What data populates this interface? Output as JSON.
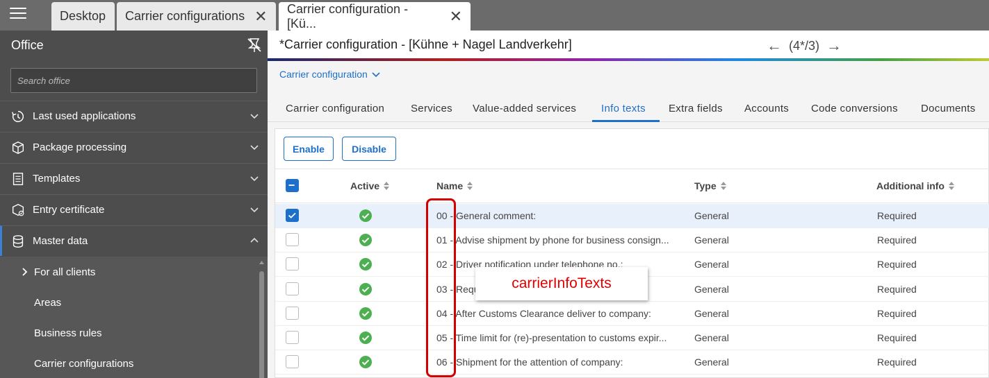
{
  "tabs": [
    {
      "label": "Desktop"
    },
    {
      "label": "Carrier configurations"
    },
    {
      "label": "Carrier configuration - [Kü..."
    }
  ],
  "sidebar": {
    "title": "Office",
    "search_placeholder": "Search office",
    "items": [
      {
        "label": "Last used applications",
        "icon": "history-icon"
      },
      {
        "label": "Package processing",
        "icon": "package-icon"
      },
      {
        "label": "Templates",
        "icon": "document-icon"
      },
      {
        "label": "Entry certificate",
        "icon": "certificate-icon"
      },
      {
        "label": "Master data",
        "icon": "database-icon"
      }
    ],
    "subitems": [
      {
        "label": "For all clients"
      },
      {
        "label": "Areas"
      },
      {
        "label": "Business rules"
      },
      {
        "label": "Carrier configurations"
      }
    ]
  },
  "header": {
    "title": "*Carrier configuration - [Kühne + Nagel Landverkehr]",
    "nav_position": "(4*/3)"
  },
  "breadcrumb": "Carrier configuration",
  "section_tabs": [
    "Carrier configuration",
    "Services",
    "Value-added services",
    "Info texts",
    "Extra fields",
    "Accounts",
    "Code conversions",
    "Documents"
  ],
  "buttons": {
    "enable": "Enable",
    "disable": "Disable"
  },
  "columns": {
    "active": "Active",
    "name": "Name",
    "type": "Type",
    "additional": "Additional info"
  },
  "rows": [
    {
      "name": "00 - General comment:",
      "type": "General",
      "additional": "Required"
    },
    {
      "name": "01 - Advise shipment by phone for business consign...",
      "type": "General",
      "additional": "Required"
    },
    {
      "name": "02 - Driver notification under telephone no.:",
      "type": "General",
      "additional": "Required"
    },
    {
      "name": "03 - Requ... cust...",
      "type": "General",
      "additional": "Required"
    },
    {
      "name": "04 - After Customs Clearance deliver to company:",
      "type": "General",
      "additional": "Required"
    },
    {
      "name": "05 - Time limit for (re)-presentation to customs expir...",
      "type": "General",
      "additional": "Required"
    },
    {
      "name": "06 - Shipment for the attention of company:",
      "type": "General",
      "additional": "Required"
    }
  ],
  "annotation": "carrierInfoTexts",
  "colors": {
    "accent": "#1e6fc9",
    "ok": "#4caf50",
    "annotation": "#d40000"
  }
}
